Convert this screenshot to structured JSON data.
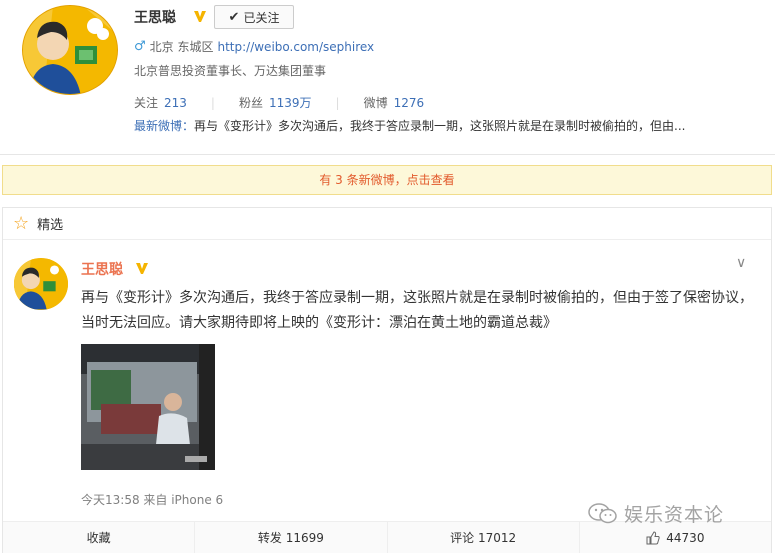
{
  "profile": {
    "name": "王思聪",
    "follow_label": "已关注",
    "location": "北京 东城区",
    "url": "http://weibo.com/sephirex",
    "bio": "北京普思投资董事长、万达集团董事",
    "following_label": "关注",
    "following_count": "213",
    "followers_label": "粉丝",
    "followers_count": "1139万",
    "weibo_label": "微博",
    "weibo_count": "1276",
    "latest_label": "最新微博：",
    "latest_text": "再与《变形计》多次沟通后，我终于答应录制一期，这张照片就是在录制时被偷拍的，但由..."
  },
  "notice": {
    "text": "有 3 条新微博，点击查看"
  },
  "feed": {
    "section_title": "精选",
    "post": {
      "author": "王思聪",
      "text": "再与《变形计》多次沟通后，我终于答应录制一期，这张照片就是在录制时被偷拍的，但由于签了保密协议，当时无法回应。请大家期待即将上映的《变形计：漂泊在黄土地的霸道总裁》",
      "meta": "今天13:58 来自 iPhone 6"
    },
    "actions": {
      "collect": "收藏",
      "repost": "转发 11699",
      "comment": "评论 17012",
      "like": "44730"
    }
  },
  "watermark": "娱乐资本论",
  "colors": {
    "link": "#3d6fb6",
    "name": "#eb7350",
    "notice_bg": "#fdf8d9",
    "notice_text": "#e25a2c",
    "verified": "#f5b400"
  }
}
